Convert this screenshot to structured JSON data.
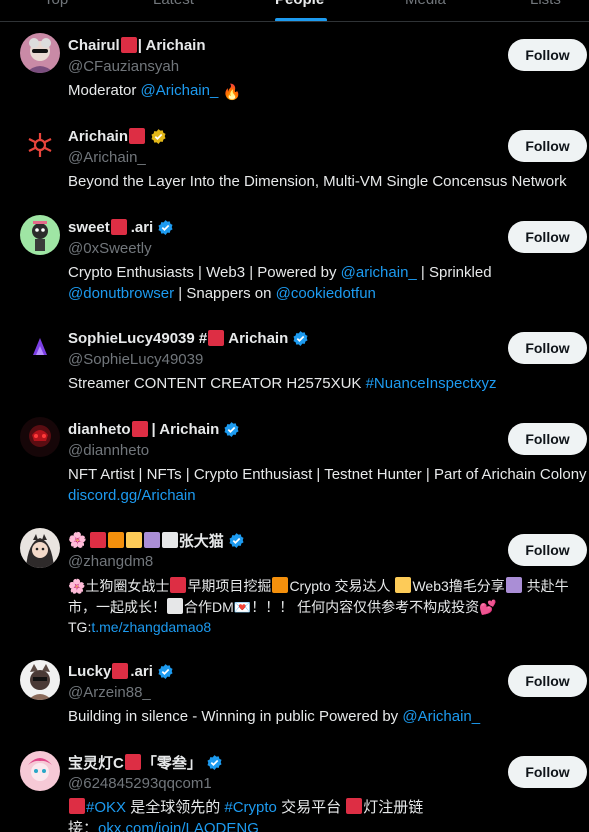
{
  "tabs": [
    "Top",
    "Latest",
    "People",
    "Media",
    "Lists"
  ],
  "follow_label": "Follow",
  "users": [
    {
      "name_pre": "Chairul ",
      "name_post": "| Arichain",
      "handle": "@CFauziansyah",
      "bio_a": "Moderator ",
      "bio_link1": "@Arichain_",
      "fire": "🔥",
      "badge": "none"
    },
    {
      "name_pre": "Arichain ",
      "name_post": "",
      "handle": "@Arichain_",
      "bio_a": "Beyond the Layer Into the Dimension, Multi-VM Single Concensus Network",
      "badge": "gold"
    },
    {
      "name_pre": "sweet ",
      "name_post": ".ari",
      "handle": "@0xSweetly",
      "bio_a": "Crypto Enthusiasts | Web3 | Powered by ",
      "bio_link1": "@arichain_",
      "bio_b": " | Sprinkled ",
      "bio_link2": "@donutbrowser",
      "bio_c": " | Snappers on ",
      "bio_link3": "@cookiedotfun",
      "badge": "blue"
    },
    {
      "name_pre": "SophieLucy49039 #",
      "name_post": " Arichain",
      "handle": "@SophieLucy49039",
      "bio_a": "Streamer CONTENT CREATOR H2575XUK ",
      "bio_link1": "#NuanceInspectxyz",
      "badge": "blue"
    },
    {
      "name_pre": "dianheto ",
      "name_post": " | Arichain",
      "handle": "@diannheto",
      "bio_a": "NFT Artist | NFTs | Crypto Enthusiast | Testnet Hunter | Part of Arichain Colony",
      "bio_link1": "discord.gg/Arichain",
      "badge": "blue"
    },
    {
      "name_pre": "🌸",
      "name_post": "张大猫",
      "handle": "@zhangdm8",
      "bio_a": "🌸土狗圈女战士",
      "bio_b": "早期项目挖掘",
      "bio_c": "Crypto 交易达人 ",
      "bio_d": "Web3撸毛分享",
      "bio_e": " 共赴牛市，一起成长！",
      "bio_f": "合作DM💌！！！ 任何内容仅供参考不构成投资💕",
      "bio_g": "TG:",
      "bio_link1": "t.me/zhangdamao8",
      "badge": "blue"
    },
    {
      "name_pre": "Lucky ",
      "name_post": ".ari",
      "handle": "@Arzein88_",
      "bio_a": "Building in silence - Winning in public Powered by ",
      "bio_link1": "@Arichain_",
      "badge": "blue"
    },
    {
      "name_pre": "宝灵灯C",
      "name_post": "「零叁」",
      "handle": "@624845293qqcom1",
      "bio_link1": "#OKX",
      "bio_a": " 是全球领先的 ",
      "bio_link2": "#Crypto",
      "bio_b": " 交易平台 ",
      "bio_c": "灯注册链",
      "bio_d": "接：",
      "bio_link3": "okx.com/join/LAODENG",
      "badge": "blue"
    }
  ],
  "colors": {
    "background": "#000000",
    "text": "#e7e9ea",
    "secondary": "#71767b",
    "link": "#1d9bf0",
    "verified_blue": "#1d9bf0",
    "verified_gold": "#e2b719",
    "follow_bg": "#eff3f4",
    "emoji_red_square": "#dd2e44"
  }
}
